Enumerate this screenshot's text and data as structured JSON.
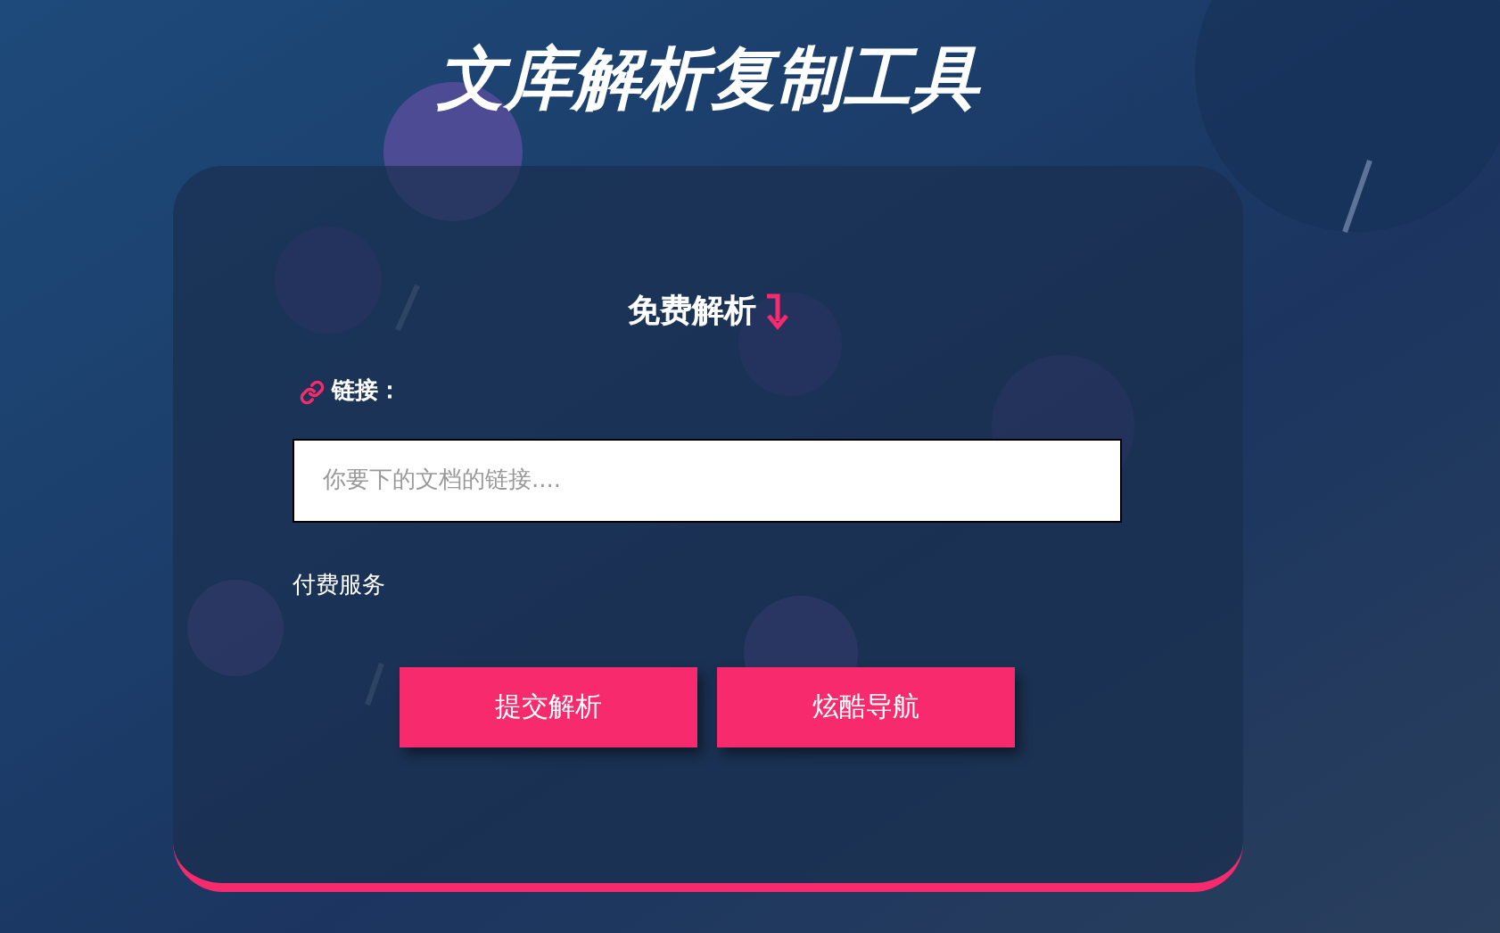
{
  "title": "文库解析复制工具",
  "card": {
    "heading": "免费解析",
    "link_label": "链接：",
    "link_field": {
      "placeholder": "你要下的文档的链接...."
    },
    "paid_label": "付费服务",
    "buttons": [
      "提交解析",
      "炫酷导航"
    ]
  }
}
